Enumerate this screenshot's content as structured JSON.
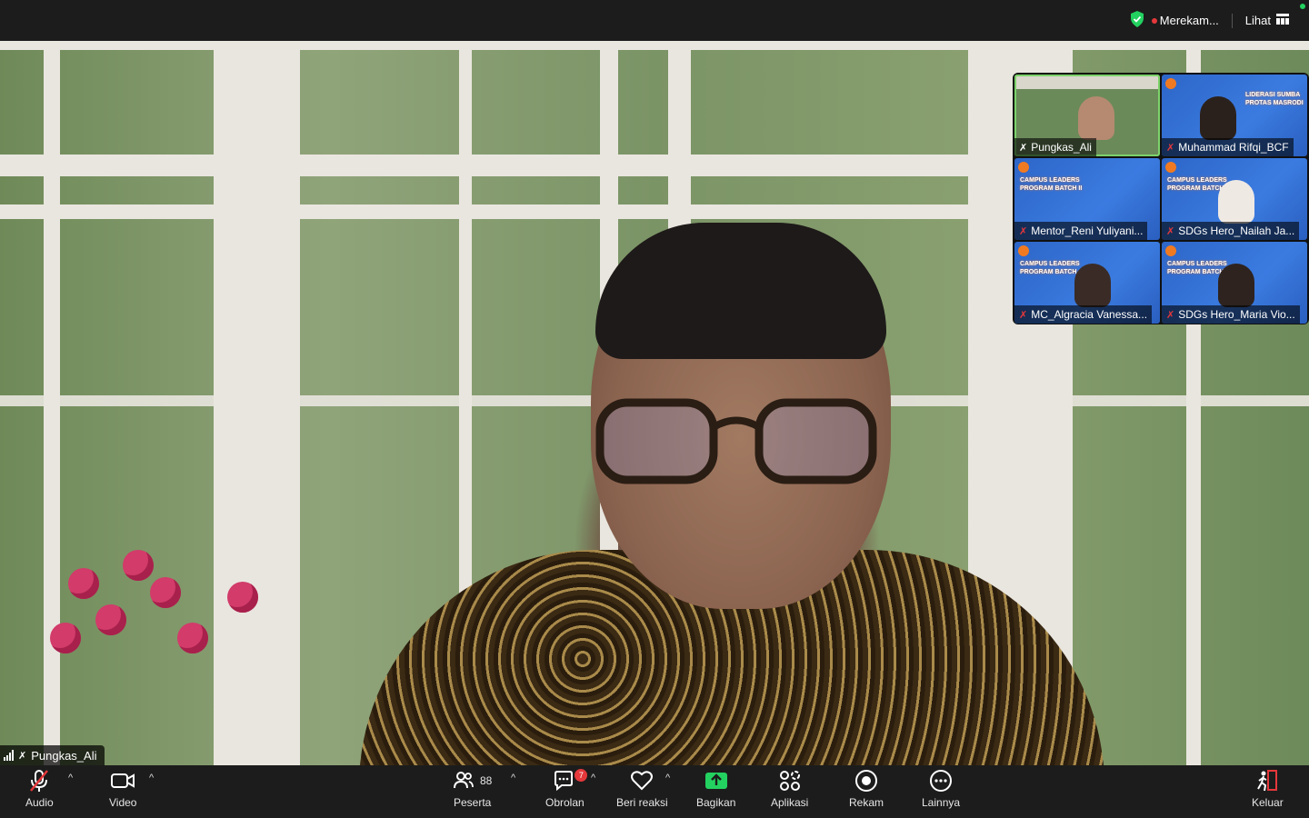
{
  "top_bar": {
    "recording_label": "Merekam...",
    "view_label": "Lihat",
    "colors": {
      "recording": "#e5383b",
      "shield": "#23d160"
    }
  },
  "main_speaker": {
    "name": "Pungkas_Ali"
  },
  "gallery": [
    {
      "name": "Pungkas_Ali",
      "active": true
    },
    {
      "name": "Muhammad Rifqi_BCF",
      "banner_text": "LIDERASI SUMBA\nPROTAS MASRODI"
    },
    {
      "name": "Mentor_Reni Yuliyani...",
      "banner_text": "CAMPUS LEADERS\nPROGRAM BATCH II"
    },
    {
      "name": "SDGs Hero_Nailah Ja...",
      "banner_text": "CAMPUS LEADERS\nPROGRAM BATCH"
    },
    {
      "name": "MC_Algracia Vanessa...",
      "banner_text": "CAMPUS LEADERS\nPROGRAM BATCH"
    },
    {
      "name": "SDGs Hero_Maria Vio...",
      "banner_text": "CAMPUS LEADERS\nPROGRAM BATCH"
    }
  ],
  "toolbar": {
    "audio": "Audio",
    "video": "Video",
    "participants": "Peserta",
    "participant_count": "88",
    "chat": "Obrolan",
    "chat_badge": "7",
    "reactions": "Beri reaksi",
    "share": "Bagikan",
    "apps": "Aplikasi",
    "record": "Rekam",
    "more": "Lainnya",
    "leave": "Keluar",
    "colors": {
      "share": "#23d160",
      "leave": "#e5383b",
      "accent_active": "#7cd36a"
    }
  }
}
